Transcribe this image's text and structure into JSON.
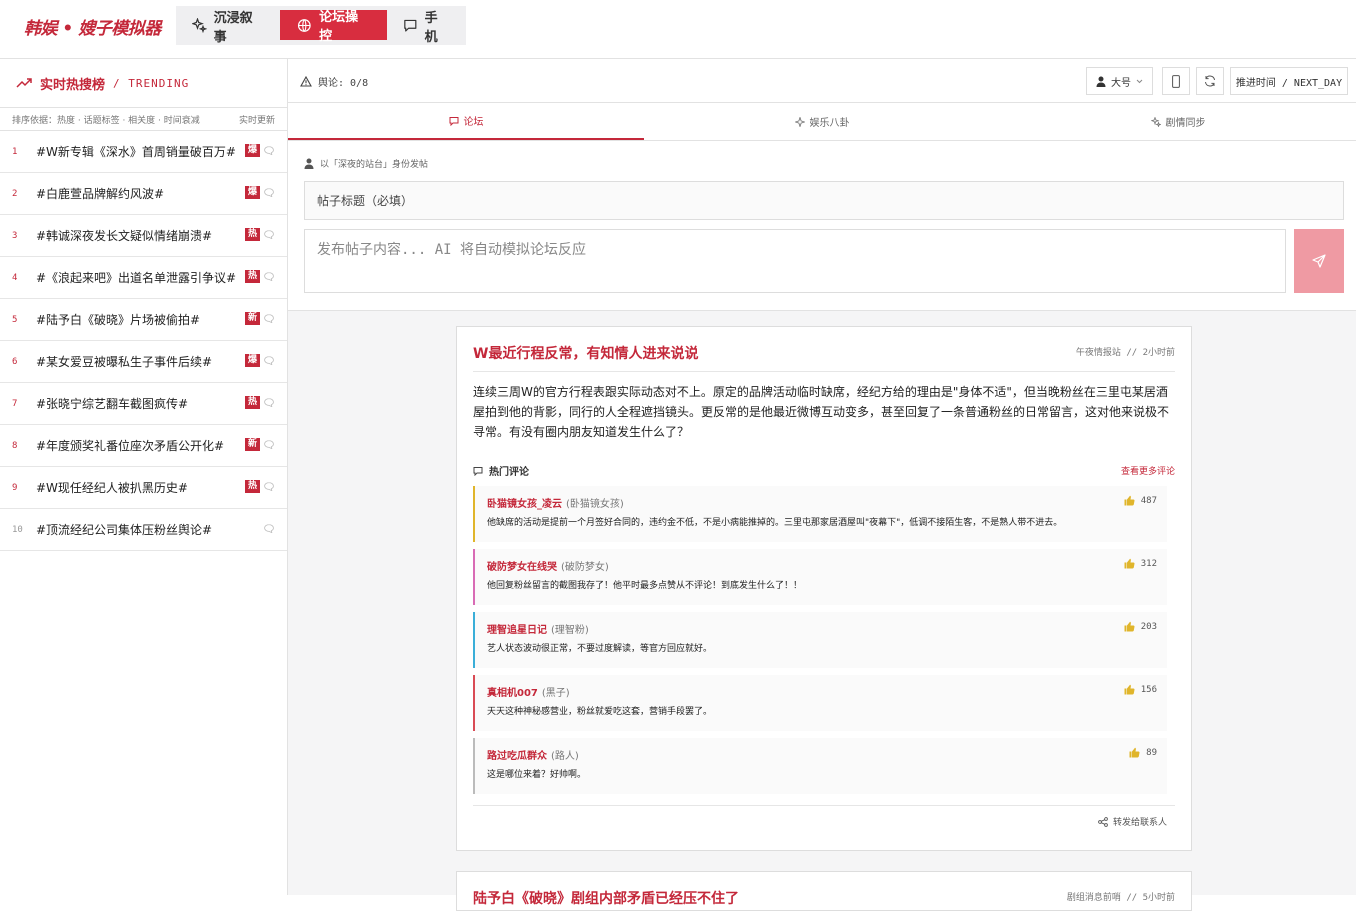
{
  "app": {
    "logo": "韩娱 • 嫂子模拟器",
    "modes": [
      {
        "label": "沉浸叙事",
        "icon": "sparkles-icon"
      },
      {
        "label": "论坛操控",
        "icon": "globe-icon",
        "active": true
      },
      {
        "label": "手机",
        "icon": "chat-icon"
      }
    ]
  },
  "sidebar": {
    "title": "实时热搜榜",
    "subtitle": "/ TRENDING",
    "sort_label": "排序依据：热度 · 话题标签 · 相关度 · 时间衰减",
    "live_label": "实时更新",
    "items": [
      {
        "rank": "1",
        "title": "#W新专辑《深水》首周销量破百万#",
        "badge": "爆"
      },
      {
        "rank": "2",
        "title": "#白鹿萱品牌解约风波#",
        "badge": "爆"
      },
      {
        "rank": "3",
        "title": "#韩诚深夜发长文疑似情绪崩溃#",
        "badge": "热"
      },
      {
        "rank": "4",
        "title": "#《浪起来吧》出道名单泄露引争议#",
        "badge": "热"
      },
      {
        "rank": "5",
        "title": "#陆予白《破晓》片场被偷拍#",
        "badge": "新"
      },
      {
        "rank": "6",
        "title": "#某女爱豆被曝私生子事件后续#",
        "badge": "爆"
      },
      {
        "rank": "7",
        "title": "#张晓宁综艺翻车截图疯传#",
        "badge": "热"
      },
      {
        "rank": "8",
        "title": "#年度颁奖礼番位座次矛盾公开化#",
        "badge": "新"
      },
      {
        "rank": "9",
        "title": "#W现任经纪人被扒黑历史#",
        "badge": "热"
      },
      {
        "rank": "10",
        "title": "#顶流经纪公司集体压粉丝舆论#",
        "badge": ""
      }
    ]
  },
  "toolbar": {
    "public_opinion": "舆论: 0/8",
    "account": "大号",
    "advance_time": "推进时间 / NEXT_DAY"
  },
  "tabs": [
    {
      "label": "论坛",
      "icon": "chat-icon",
      "active": true
    },
    {
      "label": "娱乐八卦",
      "icon": "sparkle-icon"
    },
    {
      "label": "剧情同步",
      "icon": "sparkles-icon"
    }
  ],
  "composer": {
    "posting_as": "以「深夜的站台」身份发帖",
    "title_placeholder": "帖子标题（必填）",
    "body_placeholder": "发布帖子内容... AI 将自动模拟论坛反应"
  },
  "post": {
    "title": "W最近行程反常，有知情人进来说说",
    "meta": "午夜情报站 // 2小时前",
    "body": "连续三周W的官方行程表跟实际动态对不上。原定的品牌活动临时缺席，经纪方给的理由是\"身体不适\"，但当晚粉丝在三里屯某居酒屋拍到他的背影，同行的人全程遮挡镜头。更反常的是他最近微博互动变多，甚至回复了一条普通粉丝的日常留言，这对他来说极不寻常。有没有圈内朋友知道发生什么了？",
    "hot_label": "热门评论",
    "more_label": "查看更多评论",
    "share_label": "转发给联系人",
    "comments": [
      {
        "name": "卧猫镜女孩_凌云",
        "tag": "(卧猫镜女孩)",
        "text": "他缺席的活动是提前一个月签好合同的，违约金不低，不是小病能推掉的。三里屯那家居酒屋叫\"夜幕下\"，低调不接陌生客，不是熟人带不进去。",
        "likes": "487",
        "color": "#e0b52b"
      },
      {
        "name": "破防梦女在线哭",
        "tag": "(破防梦女)",
        "text": "他回复粉丝留言的截图我存了！他平时最多点赞从不评论！到底发生什么了！！",
        "likes": "312",
        "color": "#d86bb5"
      },
      {
        "name": "理智追星日记",
        "tag": "(理智粉)",
        "text": "艺人状态波动很正常，不要过度解读，等官方回应就好。",
        "likes": "203",
        "color": "#3aaed8"
      },
      {
        "name": "真相机007",
        "tag": "(黑子)",
        "text": "天天这种神秘感营业，粉丝就爱吃这套，营销手段罢了。",
        "likes": "156",
        "color": "#d94b55"
      },
      {
        "name": "路过吃瓜群众",
        "tag": "(路人)",
        "text": "这是哪位来着？好帅啊。",
        "likes": "89",
        "color": "#bbbbbb"
      }
    ]
  },
  "post2": {
    "title": "陆予白《破晓》剧组内部矛盾已经压不住了",
    "meta": "剧组消息前哨 // 5小时前"
  },
  "colors": {
    "accent": "#c4283a",
    "accent_bright": "#d82d3f",
    "send_disabled": "#ef9aa3"
  }
}
